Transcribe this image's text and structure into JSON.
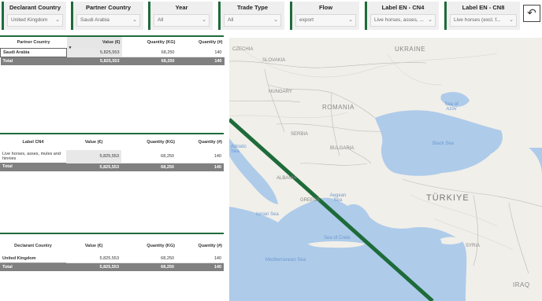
{
  "filters": [
    {
      "title": "Declarant Country",
      "value": "United Kingdom"
    },
    {
      "title": "Partner Country",
      "value": "Saudi Arabia"
    },
    {
      "title": "Year",
      "value": "All"
    },
    {
      "title": "Trade Type",
      "value": "All"
    },
    {
      "title": "Flow",
      "value": "export"
    },
    {
      "title": "Label EN - CN4",
      "value": "Live horses, asses, ..."
    },
    {
      "title": "Label EN - CN8",
      "value": "Live horses (excl. f..."
    }
  ],
  "reset_icon": "↶",
  "table1": {
    "headers": [
      "Partner Country",
      "Value (€)",
      "Quantity (KG)",
      "Quantity (#)"
    ],
    "row": [
      "Saudi Arabia",
      "5,825,553",
      "68,250",
      "140"
    ],
    "total": [
      "Total",
      "5,825,553",
      "68,250",
      "140"
    ]
  },
  "table2": {
    "headers": [
      "Label CN4",
      "Value (€)",
      "Quantity (KG)",
      "Quantity (#)"
    ],
    "row": [
      "Live horses, asses, mules and hinnies",
      "5,825,553",
      "68,250",
      "140"
    ],
    "total": [
      "Total",
      "5,825,553",
      "68,250",
      "140"
    ]
  },
  "table3": {
    "headers": [
      "Declarant Country",
      "Value (€)",
      "Quantity (KG)",
      "Quantity (#)"
    ],
    "row": [
      "United Kingdom",
      "5,825,553",
      "68,250",
      "140"
    ],
    "total": [
      "Total",
      "5,825,553",
      "68,250",
      "140"
    ]
  },
  "map": {
    "labels": {
      "czechia": "CZECHIA",
      "slovakia": "SLOVAKIA",
      "ukraine": "UKRAINE",
      "hungary": "HUNGARY",
      "romania": "ROMANIA",
      "sea_of_azov": "Sea of Azov",
      "serbia": "SERBIA",
      "bulgaria": "BULGARIA",
      "black_sea": "Black Sea",
      "adriatic_sea": "Adriatic Sea",
      "albania": "ALBANIA",
      "greece": "GREECE",
      "aegean_sea": "Aegean Sea",
      "turkiye": "TÜRKIYE",
      "ionian_sea": "Ionian Sea",
      "sea_of_crete": "Sea of Crete",
      "mediterranean_sea": "Mediterranean Sea",
      "syria": "SYRIA",
      "iraq": "IRAQ"
    },
    "route_color": "#1e6b3a"
  }
}
